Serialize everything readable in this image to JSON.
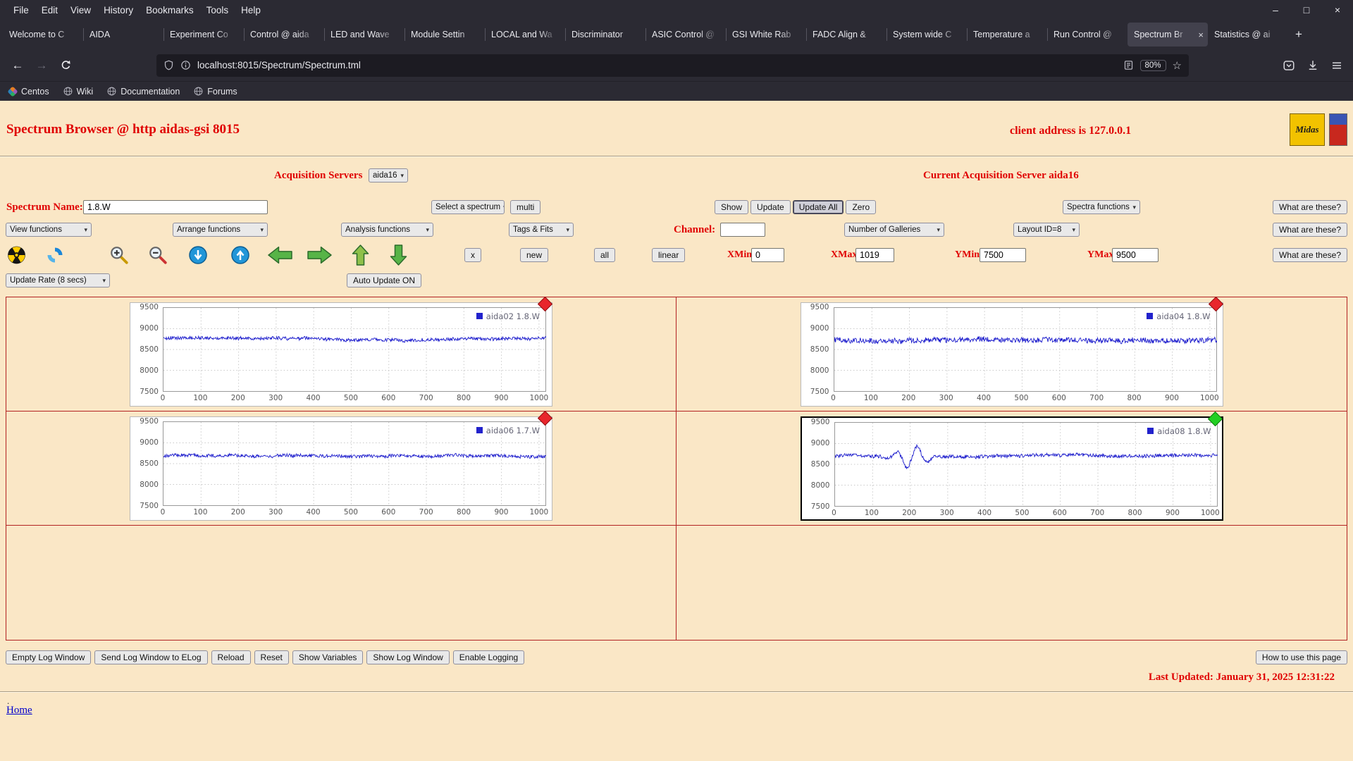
{
  "icons": {
    "back": "←",
    "forward": "→",
    "minimize": "–",
    "maximize": "□",
    "close_window": "×",
    "close_tab": "×",
    "new_tab": "+",
    "star": "☆",
    "select_arrow": "▾"
  },
  "browser": {
    "menu": [
      "File",
      "Edit",
      "View",
      "History",
      "Bookmarks",
      "Tools",
      "Help"
    ],
    "tabs": [
      "Welcome to C",
      "AIDA",
      "Experiment Co",
      "Control @ aida",
      "LED and Wave",
      "Module Settin",
      "LOCAL and Wa",
      "Discriminator",
      "ASIC Control @",
      "GSI White Rab",
      "FADC Align &",
      "System wide C",
      "Temperature a",
      "Run Control @",
      "Spectrum Br",
      "Statistics @ ai"
    ],
    "active_tab_index": 14,
    "url": "localhost:8015/Spectrum/Spectrum.tml",
    "zoom_level": "80%",
    "bookmarks": [
      "Centos",
      "Wiki",
      "Documentation",
      "Forums"
    ]
  },
  "header": {
    "title": "Spectrum Browser @ http aidas-gsi 8015",
    "client_address": "client address is 127.0.0.1",
    "midas_logo_text": "Midas"
  },
  "acquisition": {
    "label": "Acquisition Servers",
    "server": "aida16",
    "current": "Current Acquisition Server aida16"
  },
  "controls": {
    "spectrum_name_label": "Spectrum Name:",
    "spectrum_name_value": "1.8.W",
    "select_spectrum": "Select a spectrum",
    "multi": "multi",
    "show": "Show",
    "update": "Update",
    "update_all": "Update All",
    "zero": "Zero",
    "spectra_functions": "Spectra functions",
    "what_are_these": "What are these?",
    "view_functions": "View functions",
    "arrange_functions": "Arrange functions",
    "analysis_functions": "Analysis functions",
    "tags_fits": "Tags & Fits",
    "channel_label": "Channel:",
    "channel_value": "",
    "number_of_galleries": "Number of Galleries",
    "layout_id": "Layout ID=8",
    "x": "x",
    "new": "new",
    "all": "all",
    "linear": "linear",
    "xmin_label": "XMin",
    "xmin_value": "0",
    "xmax_label": "XMax",
    "xmax_value": "1019",
    "ymin_label": "YMin",
    "ymin_value": "7500",
    "ymax_label": "YMax",
    "ymax_value": "9500",
    "update_rate": "Update Rate (8 secs)",
    "auto_update": "Auto Update ON"
  },
  "footer": {
    "buttons": [
      "Empty Log Window",
      "Send Log Window to ELog",
      "Reload",
      "Reset",
      "Show Variables",
      "Show Log Window",
      "Enable Logging"
    ],
    "help_button": "How to use this page",
    "last_updated": "Last Updated: January 31, 2025 12:31:22",
    "dot": ".",
    "home": "Home"
  },
  "chart_data": {
    "type": "line",
    "grid": true,
    "legend_position": "top-right",
    "line_color": "#1a1acc",
    "axis": {
      "xmin": 0,
      "xmax": 1019,
      "ymin": 7500,
      "ymax": 9500,
      "xticks": [
        0,
        100,
        200,
        300,
        400,
        500,
        600,
        700,
        800,
        900,
        1000
      ],
      "yticks": [
        7500,
        8000,
        8500,
        9000,
        9500
      ]
    },
    "panels": [
      {
        "legend": "aida02 1.8.W",
        "marker": "red-diamond",
        "marker_color": "#e8262c",
        "marker_edge": "#8d0f12",
        "selected": false,
        "base": 8770,
        "noise": 40,
        "seed": 5
      },
      {
        "legend": "aida04 1.8.W",
        "marker": "red-diamond",
        "marker_color": "#e8262c",
        "marker_edge": "#8d0f12",
        "selected": false,
        "base": 8740,
        "noise": 65,
        "seed": 12
      },
      {
        "legend": "aida06 1.7.W",
        "marker": "red-diamond",
        "marker_color": "#e8262c",
        "marker_edge": "#8d0f12",
        "selected": false,
        "base": 8690,
        "noise": 38,
        "seed": 23
      },
      {
        "legend": "aida08 1.8.W",
        "marker": "green-diamond",
        "marker_color": "#22cf22",
        "marker_edge": "#0c7a0c",
        "selected": true,
        "base": 8700,
        "noise": 42,
        "seed": 31,
        "burst": {
          "center": 205,
          "sigma": 32,
          "freq": 0.11,
          "amp": 270
        }
      }
    ]
  }
}
